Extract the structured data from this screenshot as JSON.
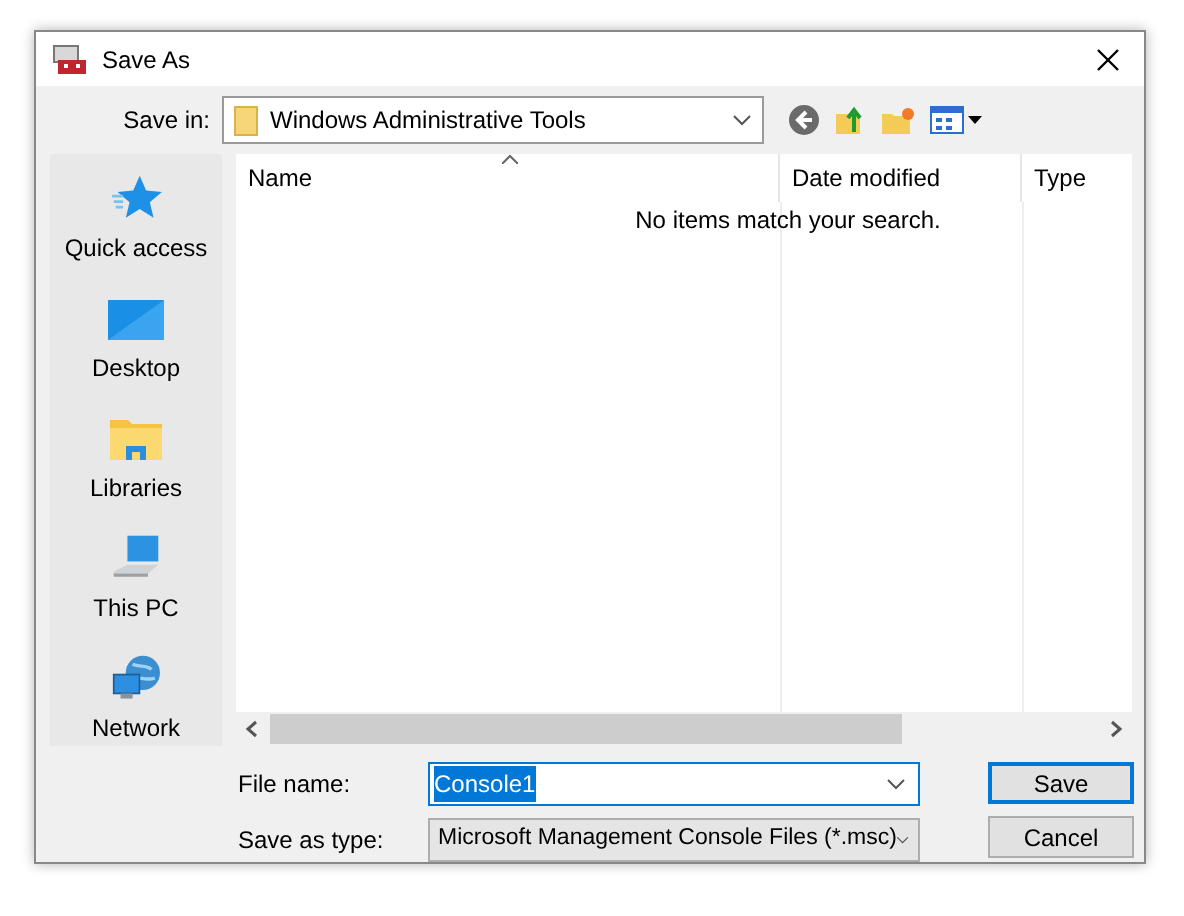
{
  "window": {
    "title": "Save As"
  },
  "save_in": {
    "label": "Save in:",
    "value": "Windows Administrative Tools"
  },
  "places": [
    {
      "label": "Quick access",
      "kind": "star"
    },
    {
      "label": "Desktop",
      "kind": "desktop"
    },
    {
      "label": "Libraries",
      "kind": "libraries"
    },
    {
      "label": "This PC",
      "kind": "pc"
    },
    {
      "label": "Network",
      "kind": "network"
    }
  ],
  "columns": [
    "Name",
    "Date modified",
    "Type"
  ],
  "empty_message": "No items match your search.",
  "file_name": {
    "label": "File name:",
    "value": "Console1"
  },
  "save_as_type": {
    "label": "Save as type:",
    "value": "Microsoft Management Console Files (*.msc)"
  },
  "buttons": [
    "Save",
    "Cancel"
  ]
}
